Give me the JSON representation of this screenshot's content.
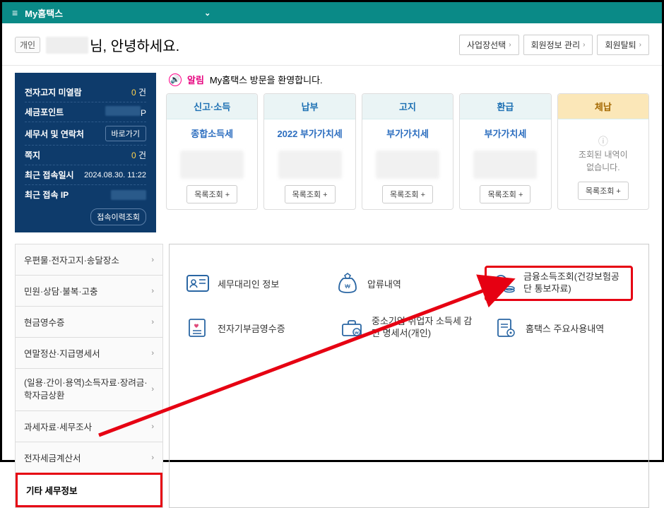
{
  "topbar": {
    "title": "My홈택스"
  },
  "header": {
    "badge": "개인",
    "greeting_suffix": "님, 안녕하세요.",
    "buttons": [
      "사업장선택",
      "회원정보 관리",
      "회원탈퇴"
    ]
  },
  "sidebar": {
    "rows": [
      {
        "label": "전자고지 미열람",
        "value_num": "0",
        "value_unit": " 건"
      },
      {
        "label": "세금포인트",
        "value_unit": "P",
        "blurred": true
      },
      {
        "label": "세무서 및 연락처",
        "button": "바로가기"
      },
      {
        "label": "쪽지",
        "value_num": "0",
        "value_unit": " 건"
      },
      {
        "label": "최근 접속일시",
        "value_text": "2024.08.30. 11:22"
      },
      {
        "label": "최근 접속 IP",
        "blurred": true
      }
    ],
    "history_btn": "접속이력조회"
  },
  "alert": {
    "label": "알림",
    "text": "My홈택스 방문을 환영합니다."
  },
  "tabcards": [
    {
      "head": "신고·소득",
      "sub": "종합소득세",
      "footer": "목록조회 +"
    },
    {
      "head": "납부",
      "sub": "2022 부가가치세",
      "footer": "목록조회 +"
    },
    {
      "head": "고지",
      "sub": "부가가치세",
      "footer": "목록조회 +"
    },
    {
      "head": "환급",
      "sub": "부가가치세",
      "footer": "목록조회 +"
    },
    {
      "head": "체납",
      "empty_icon": "!",
      "empty_msg1": "조회된 내역이",
      "empty_msg2": "없습니다.",
      "footer": "목록조회 +",
      "orange": true
    }
  ],
  "menu": [
    "우편물·전자고지·송달장소",
    "민원·상담·불복·고충",
    "현금영수증",
    "연말정산·지급명세서",
    "(일용·간이·용역)소득자료·장려금·학자금상환",
    "과세자료·세무조사",
    "전자세금계산서",
    "기타 세무정보"
  ],
  "grid": {
    "r1": [
      {
        "label": "세무대리인 정보"
      },
      {
        "label": "압류내역"
      },
      {
        "label": "금융소득조회(건강보험공단 통보자료)",
        "highlight": true
      }
    ],
    "r2": [
      {
        "label": "전자기부금영수증"
      },
      {
        "label": "중소기업 취업자 소득세 감면 명세서(개인)"
      },
      {
        "label": "홈택스 주요사용내역"
      }
    ]
  }
}
